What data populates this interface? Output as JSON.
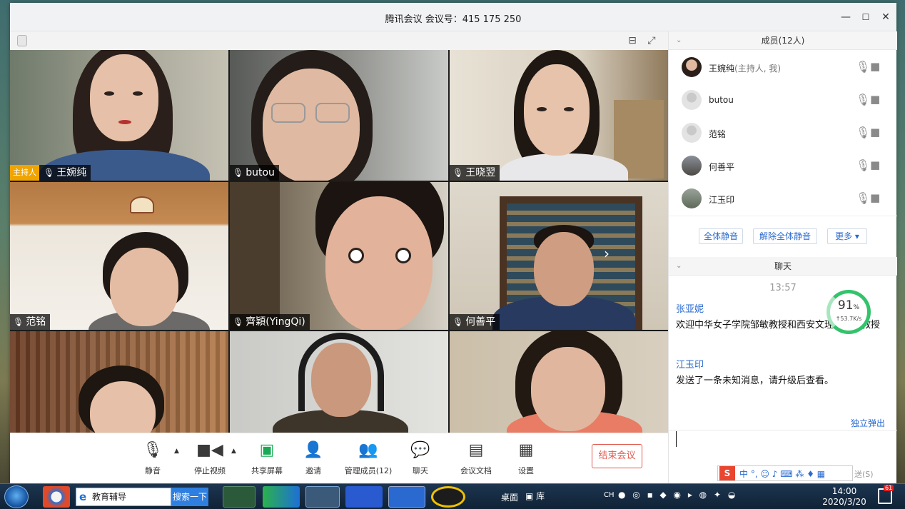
{
  "window": {
    "title": "腾讯会议 会议号：415 175 250",
    "minimize": "—",
    "maximize": "☐",
    "close": "✕"
  },
  "video": {
    "participants": [
      {
        "name": "王婉纯",
        "host_badge": "主持人"
      },
      {
        "name": "butou"
      },
      {
        "name": "王晓翌"
      },
      {
        "name": "范铭"
      },
      {
        "name": "齊穎(YingQi)"
      },
      {
        "name": "何善平"
      }
    ]
  },
  "toolbar": {
    "mute": "静音",
    "stop_video": "停止视频",
    "share": "共享屏幕",
    "invite": "邀请",
    "manage": "管理成员(12)",
    "chat": "聊天",
    "docs": "会议文档",
    "settings": "设置",
    "end": "结束会议"
  },
  "members": {
    "header": "成员(12人)",
    "list": [
      {
        "name": "王婉纯",
        "note": "(主持人, 我)"
      },
      {
        "name": "butou",
        "note": ""
      },
      {
        "name": "范铭",
        "note": ""
      },
      {
        "name": "何善平",
        "note": ""
      },
      {
        "name": "江玉印",
        "note": ""
      }
    ],
    "mute_all": "全体静音",
    "unmute_all": "解除全体静音",
    "more": "更多 ▾"
  },
  "chat": {
    "header": "聊天",
    "time": "13:57",
    "messages": [
      {
        "sender": "张亚妮",
        "text": "欢迎中华女子学院邹敏教授和西安文理王晓翌教授"
      },
      {
        "sender": "江玉印",
        "text": "发送了一条未知消息，请升级后查看。"
      }
    ],
    "popout": "独立弹出",
    "send_hint": "送(S)"
  },
  "speed": {
    "percent": "91",
    "unit": "%",
    "rate": "↑53.7K/s"
  },
  "ime": {
    "label": "中 °, ☺ ♪ ⌨ ⁂ ♦ ▦"
  },
  "taskbar": {
    "search_label": "教育辅导",
    "search_btn": "搜索一下",
    "desktop": "桌面",
    "library": "库",
    "lang": "CH",
    "time": "14:00",
    "date": "2020/3/20",
    "notif_count": "61"
  },
  "colors": {
    "accent": "#2a6ad0",
    "end": "#e25a4f",
    "host": "#f0a400",
    "speed": "#33c36b"
  }
}
